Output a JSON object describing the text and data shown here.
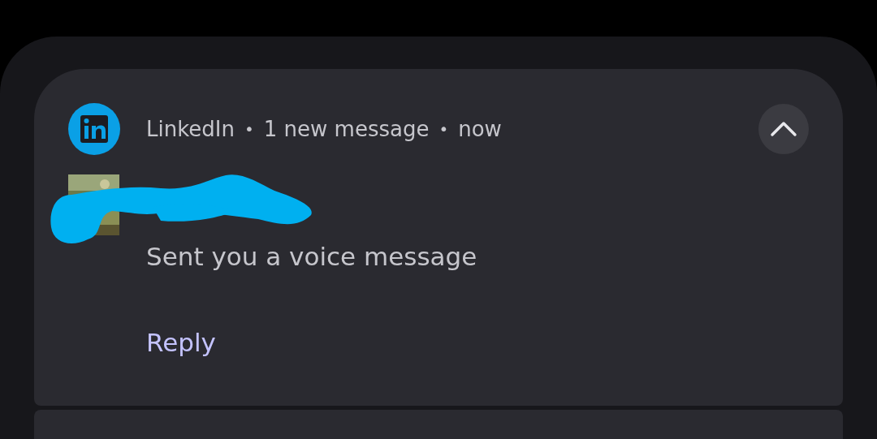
{
  "notification": {
    "app": "LinkedIn",
    "separators": [
      "•",
      "•"
    ],
    "summary": "1 new message",
    "time": "now",
    "expanded": true,
    "message": "Sent you a voice message",
    "action": "Reply"
  }
}
